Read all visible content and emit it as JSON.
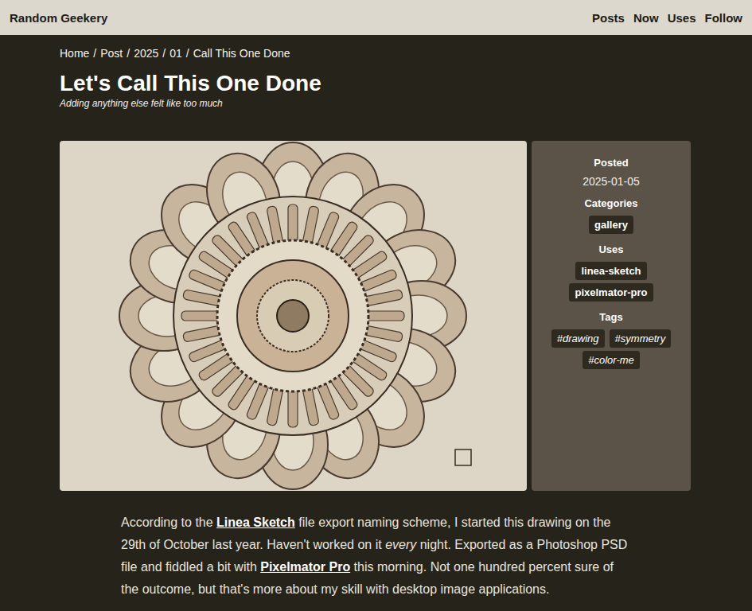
{
  "site": {
    "title": "Random Geekery"
  },
  "nav": [
    "Posts",
    "Now",
    "Uses",
    "Follow"
  ],
  "breadcrumb": {
    "separator": "/",
    "items": [
      "Home",
      "Post",
      "2025",
      "01",
      "Call This One Done"
    ]
  },
  "post": {
    "title": "Let's Call This One Done",
    "subtitle": "Adding anything else felt like too much"
  },
  "sidebar": [
    {
      "label": "Posted",
      "kind": "text",
      "value": "2025-01-05"
    },
    {
      "label": "Categories",
      "kind": "chips",
      "items": [
        "gallery"
      ]
    },
    {
      "label": "Uses",
      "kind": "chips",
      "items": [
        "linea-sketch",
        "pixelmator-pro"
      ]
    },
    {
      "label": "Tags",
      "kind": "tags",
      "items": [
        "#drawing",
        "#symmetry",
        "#color-me"
      ]
    }
  ],
  "body": [
    {
      "kind": "text",
      "text": "According to the "
    },
    {
      "kind": "link",
      "text": "Linea Sketch"
    },
    {
      "kind": "text",
      "text": " file export naming scheme, I started this drawing on the 29th of October last year. Haven't worked on it "
    },
    {
      "kind": "em",
      "text": "every"
    },
    {
      "kind": "text",
      "text": " night. Exported as a Photoshop PSD file and fiddled a bit with "
    },
    {
      "kind": "link",
      "text": "Pixelmator Pro"
    },
    {
      "kind": "text",
      "text": " this morning. Not one hundred percent sure of the outcome, but that's more about my skill with desktop image applications."
    }
  ]
}
